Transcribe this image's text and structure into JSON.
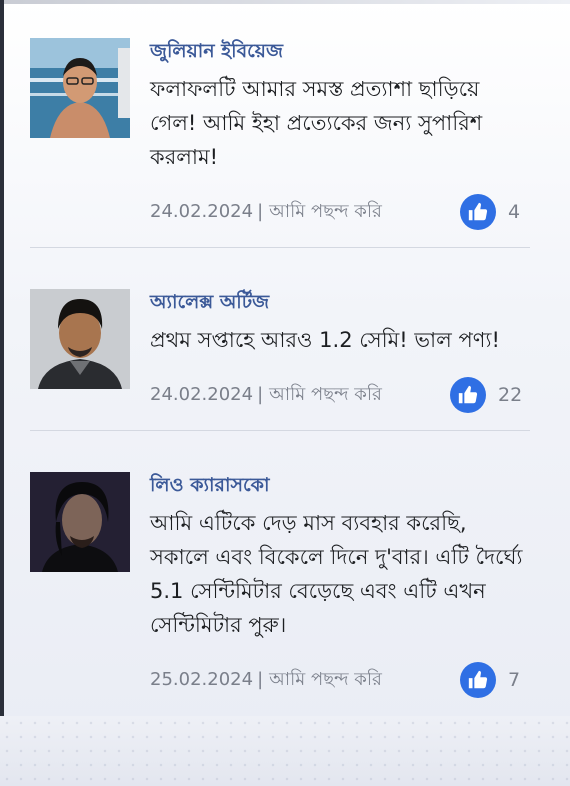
{
  "comments": [
    {
      "name": "জুলিয়ান ইবিয়েজ",
      "text": "ফলাফলটি আমার সমস্ত প্রত্যাশা ছাড়িয়ে গেল! আমি ইহা প্রত্যেকের জন্য সুপারিশ করলাম!",
      "date": "24.02.2024",
      "like_label": "আমি পছন্দ করি",
      "likes": "4",
      "avatar_icon": "avatar-photo-pool"
    },
    {
      "name": "অ্যালেক্স অর্টিজ",
      "text": "প্রথম সপ্তাহে আরও 1.2 সেমি! ভাল পণ্য!",
      "date": "24.02.2024",
      "like_label": "আমি পছন্দ করি",
      "likes": "22",
      "avatar_icon": "avatar-photo-man"
    },
    {
      "name": "লিও ক্যারাসকো",
      "text": "আমি এটিকে দেড় মাস ব্যবহার করেছি, সকালে এবং বিকেলে দিনে দু'বার। এটি দৈর্ঘ্যে 5.1 সেন্টিমিটার বেড়েছে এবং এটি এখন সেন্টিমিটার পুরু।",
      "date": "25.02.2024",
      "like_label": "আমি পছন্দ করি",
      "likes": "7",
      "avatar_icon": "avatar-photo-dark"
    }
  ],
  "separator": "|",
  "colors": {
    "name": "#3b5998",
    "like_button": "#2f6fe4",
    "meta_text": "#7a7f8a"
  }
}
